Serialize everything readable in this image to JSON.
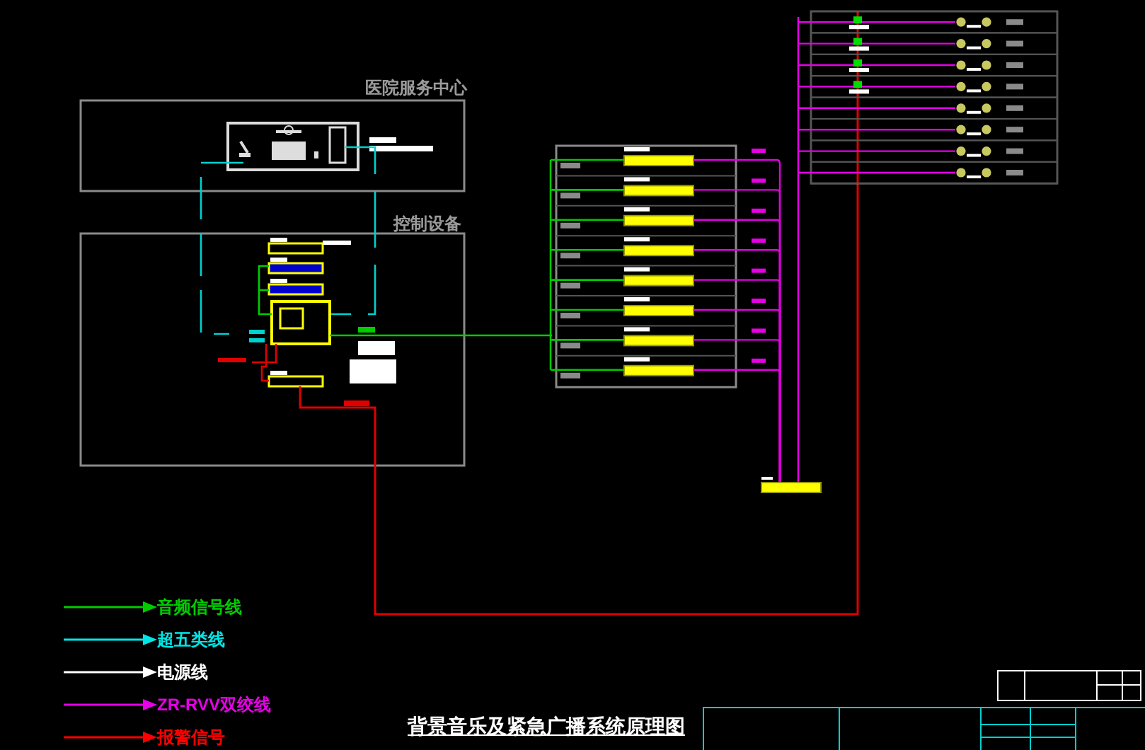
{
  "drawing_title": "背景音乐及紧急广播系统原理图",
  "rooms": [
    {
      "title": "医院服务中心"
    },
    {
      "title": "控制设备"
    }
  ],
  "amplifiers": [
    {
      "kind": "amplifier"
    },
    {
      "kind": "amplifier"
    },
    {
      "kind": "amplifier"
    },
    {
      "kind": "amplifier"
    },
    {
      "kind": "amplifier"
    },
    {
      "kind": "amplifier"
    },
    {
      "kind": "amplifier"
    },
    {
      "kind": "amplifier"
    }
  ],
  "speaker_zones": [
    {
      "relay": true
    },
    {
      "relay": true
    },
    {
      "relay": true
    },
    {
      "relay": true
    },
    {
      "relay": false
    },
    {
      "relay": false
    },
    {
      "relay": false
    },
    {
      "relay": false
    }
  ],
  "legend": [
    {
      "label": "音频信号线",
      "color": "#00cc00"
    },
    {
      "label": "超五类线",
      "color": "#00e5e5"
    },
    {
      "label": "电源线",
      "color": "#ffffff"
    },
    {
      "label": "ZR-RVV双绞线",
      "color": "#e600e6"
    },
    {
      "label": "报警信号",
      "color": "#ff0000"
    }
  ]
}
